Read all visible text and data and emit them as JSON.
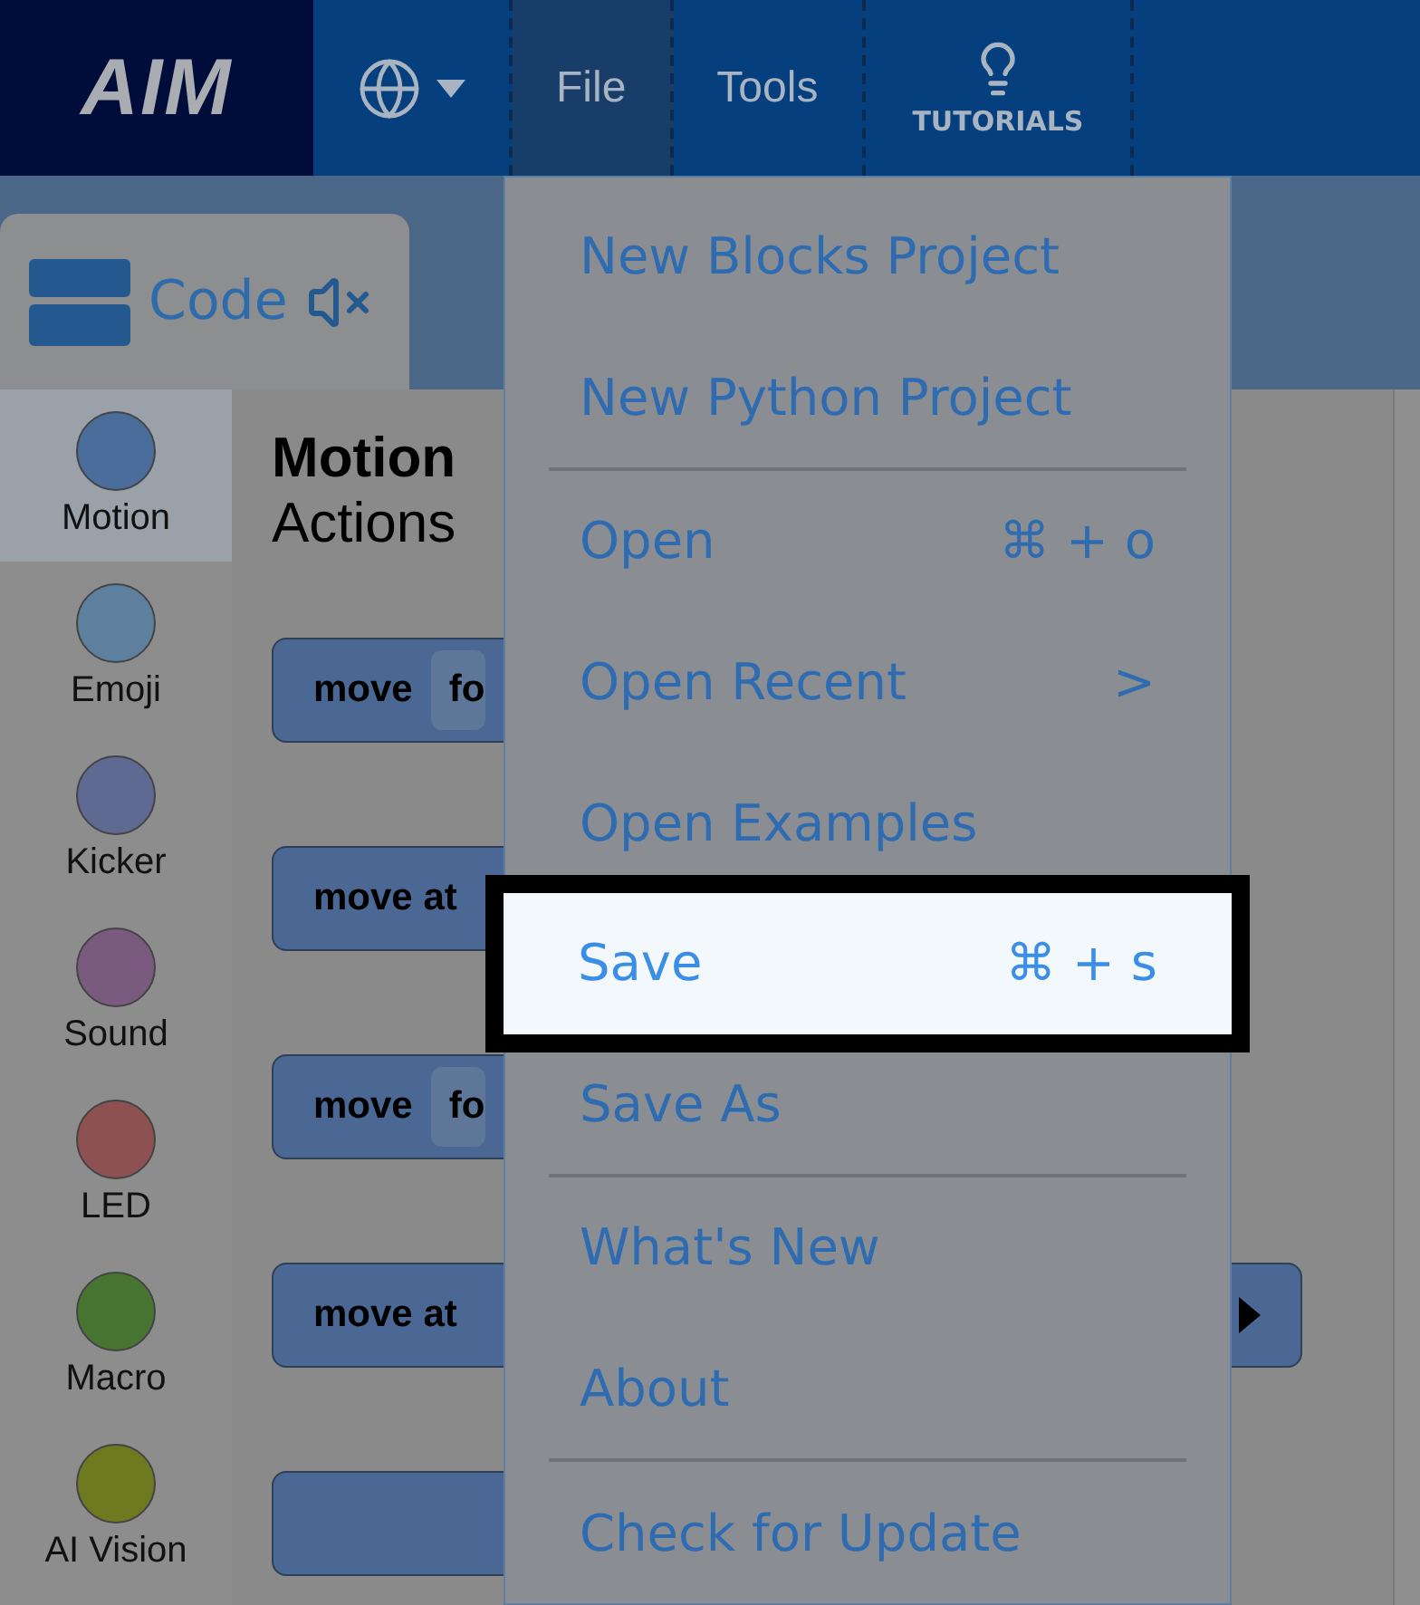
{
  "header": {
    "logo": "AIM",
    "nav": [
      {
        "kind": "language",
        "selected": false
      },
      {
        "kind": "text",
        "label": "File",
        "selected": true
      },
      {
        "kind": "text",
        "label": "Tools",
        "selected": false
      },
      {
        "kind": "tutorials",
        "label": "TUTORIALS",
        "selected": false
      }
    ]
  },
  "code_tab": {
    "label": "Code",
    "muted": true
  },
  "categories": [
    {
      "label": "Motion",
      "color": "#4b6d9b",
      "selected": true
    },
    {
      "label": "Emoji",
      "color": "#5f7f9f",
      "selected": false
    },
    {
      "label": "Kicker",
      "color": "#5f6a92",
      "selected": false
    },
    {
      "label": "Sound",
      "color": "#7a5a7f",
      "selected": false
    },
    {
      "label": "LED",
      "color": "#8c5150",
      "selected": false
    },
    {
      "label": "Macro",
      "color": "#477430",
      "selected": false
    },
    {
      "label": "AI Vision",
      "color": "#6e7a20",
      "selected": false
    }
  ],
  "palette": {
    "title": "Motion",
    "subtitle": "Actions",
    "blocks": [
      {
        "kind": "command",
        "label": "move",
        "field": "fo"
      },
      {
        "kind": "command",
        "label": "move at"
      },
      {
        "kind": "command",
        "label": "move",
        "field": "fo"
      },
      {
        "kind": "command",
        "label": "move at",
        "extends": true
      },
      {
        "kind": "command"
      }
    ]
  },
  "file_menu": [
    {
      "kind": "item",
      "label": "New Blocks Project",
      "selected": false
    },
    {
      "kind": "item",
      "label": "New Python Project",
      "selected": false
    },
    {
      "kind": "separator"
    },
    {
      "kind": "item",
      "label": "Open",
      "shortcut": "⌘ + o",
      "selected": false
    },
    {
      "kind": "item",
      "label": "Open Recent",
      "shortcut": ">",
      "selected": false
    },
    {
      "kind": "item",
      "label": "Open Examples",
      "selected": false
    },
    {
      "kind": "item",
      "label": "Save",
      "shortcut": "⌘ + s",
      "selected": true
    },
    {
      "kind": "item",
      "label": "Save As",
      "selected": false
    },
    {
      "kind": "separator"
    },
    {
      "kind": "item",
      "label": "What's New",
      "selected": false
    },
    {
      "kind": "item",
      "label": "About",
      "selected": false
    },
    {
      "kind": "separator"
    },
    {
      "kind": "item",
      "label": "Check for Update",
      "selected": false
    }
  ]
}
